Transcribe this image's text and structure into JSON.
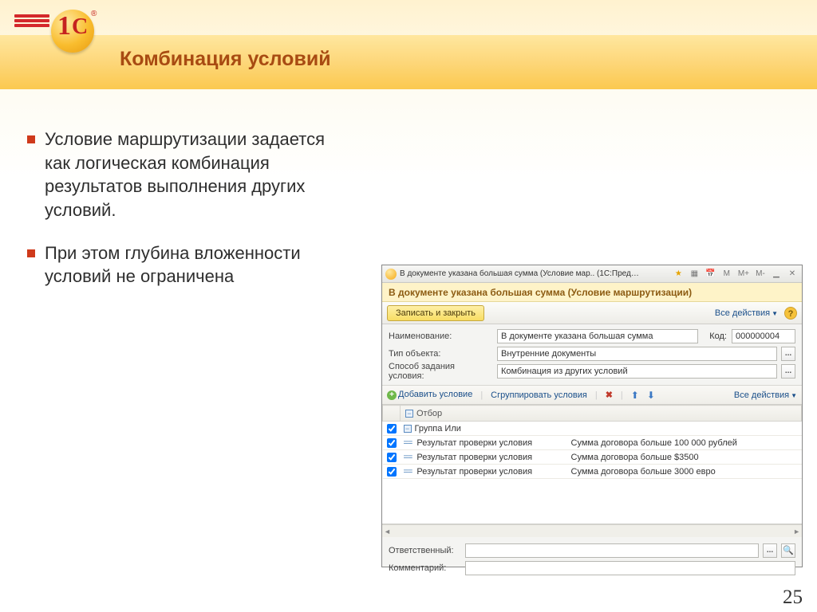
{
  "slide": {
    "title": "Комбинация условий",
    "page_number": "25",
    "bullets": [
      "Условие маршрутизации задается как логическая комбинация результатов выполнения других условий.",
      "При этом глубина вложенности условий не ограничена"
    ]
  },
  "window": {
    "titlebar": "В документе указана большая сумма (Условие мар..   (1С:Предприятие)",
    "tb_buttons": [
      "М",
      "М+",
      "М-"
    ],
    "yellow_heading": "В документе указана большая сумма (Условие маршрутизации)",
    "toolbar": {
      "main_button": "Записать и закрыть",
      "all_actions": "Все действия"
    },
    "form": {
      "name_label": "Наименование:",
      "name_value": "В документе указана большая сумма",
      "code_label": "Код:",
      "code_value": "000000004",
      "type_label": "Тип объекта:",
      "type_value": "Внутренние документы",
      "method_label": "Способ задания условия:",
      "method_value": "Комбинация из других условий"
    },
    "toolbar2": {
      "add": "Добавить условие",
      "group": "Сгруппировать условия",
      "all_actions": "Все действия"
    },
    "grid": {
      "header": "Отбор",
      "group_or": "Группа Или",
      "leaf_label": "Результат проверки условия",
      "rows": [
        "Сумма договора больше 100 000 рублей",
        "Сумма договора больше $3500",
        "Сумма договора больше 3000 евро"
      ]
    },
    "bottom": {
      "resp_label": "Ответственный:",
      "resp_value": "",
      "comment_label": "Комментарий:",
      "comment_value": ""
    }
  }
}
